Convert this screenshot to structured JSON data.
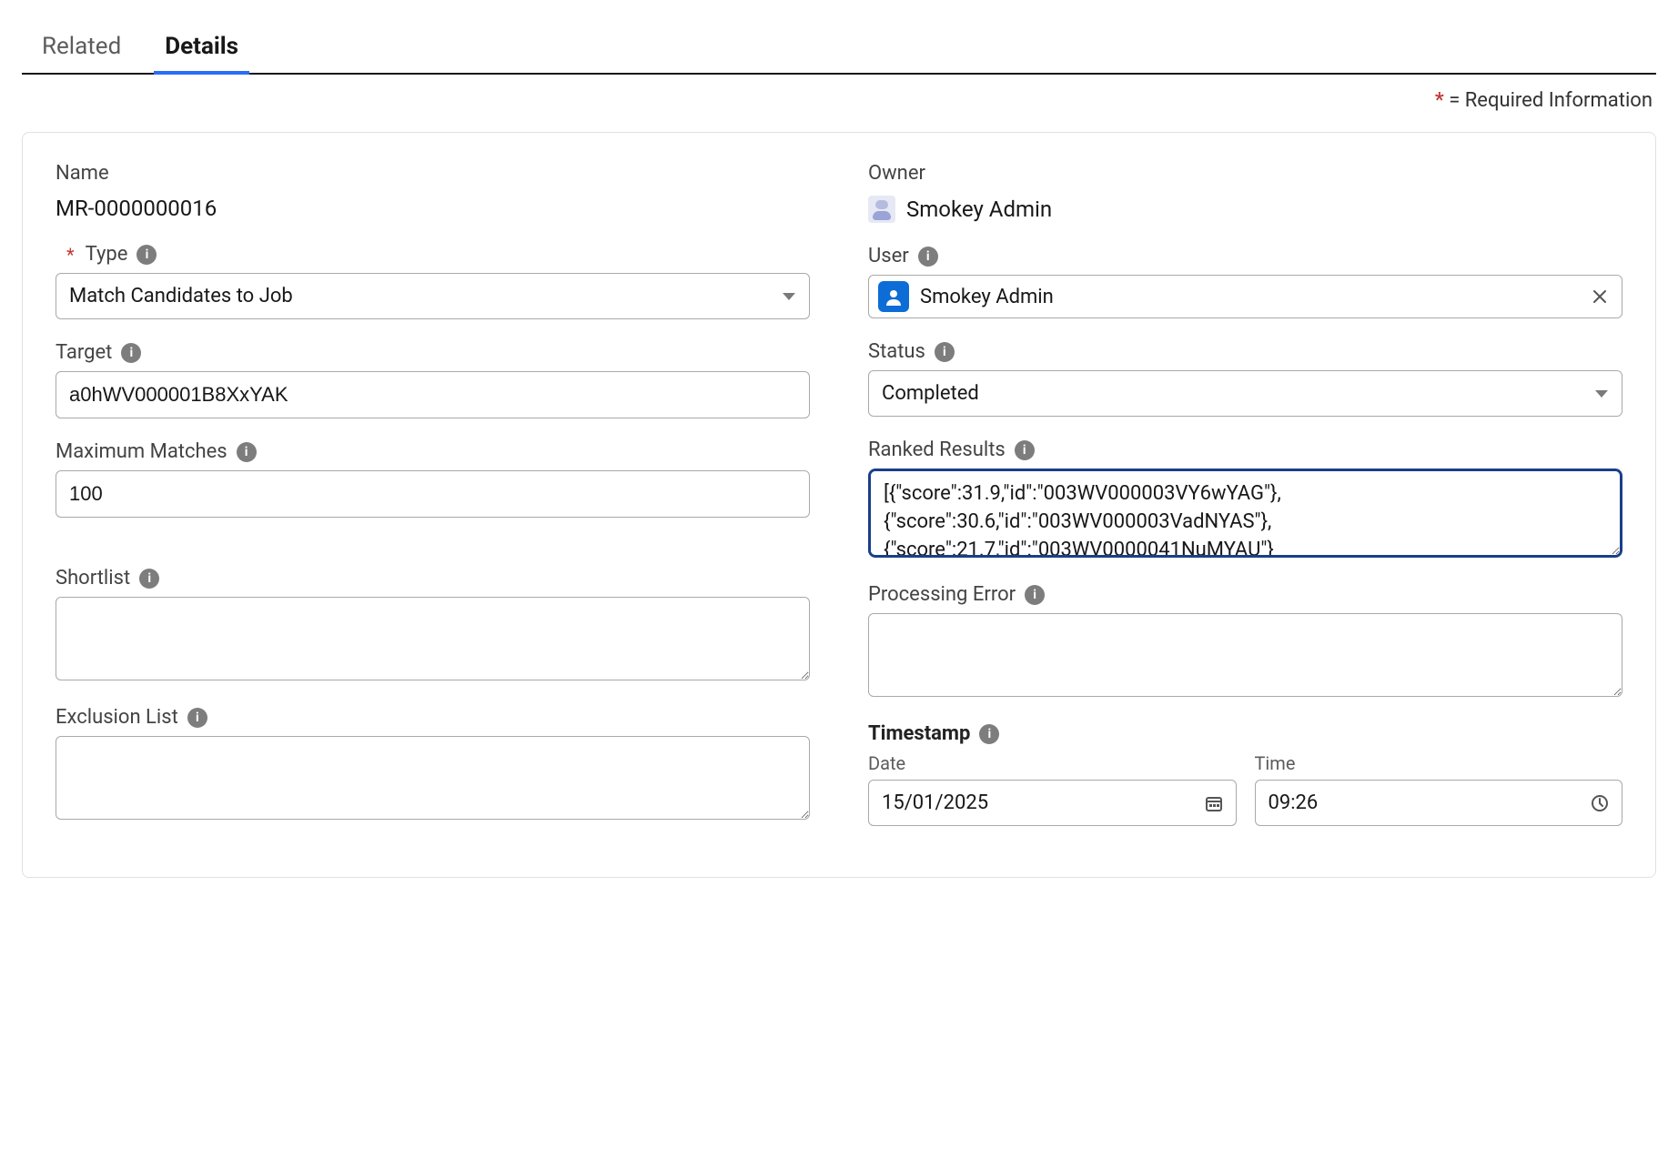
{
  "tabs": {
    "related": "Related",
    "details": "Details"
  },
  "required_hint_text": "= Required Information",
  "left": {
    "name_label": "Name",
    "name_value": "MR-0000000016",
    "type_label": "Type",
    "type_value": "Match Candidates to Job",
    "target_label": "Target",
    "target_value": "a0hWV000001B8XxYAK",
    "max_matches_label": "Maximum Matches",
    "max_matches_value": "100",
    "shortlist_label": "Shortlist",
    "shortlist_value": "",
    "exclusion_label": "Exclusion List",
    "exclusion_value": ""
  },
  "right": {
    "owner_label": "Owner",
    "owner_value": "Smokey Admin",
    "user_label": "User",
    "user_value": "Smokey Admin",
    "status_label": "Status",
    "status_value": "Completed",
    "ranked_label": "Ranked Results",
    "ranked_value": "[{\"score\":31.9,\"id\":\"003WV000003VY6wYAG\"},{\"score\":30.6,\"id\":\"003WV000003VadNYAS\"},{\"score\":21.7,\"id\":\"003WV0000041NuMYAU\"}",
    "proc_error_label": "Processing Error",
    "proc_error_value": "",
    "timestamp_label": "Timestamp",
    "date_label": "Date",
    "date_value": "15/01/2025",
    "time_label": "Time",
    "time_value": "09:26"
  }
}
